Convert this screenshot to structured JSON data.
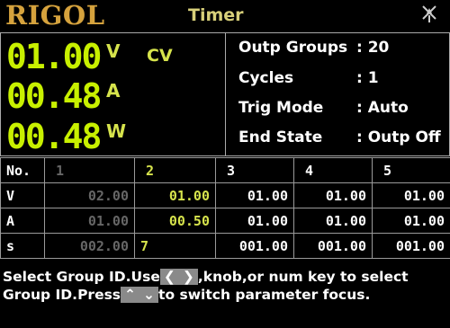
{
  "title_bar": {
    "logo": "RIGOL",
    "mode_title": "Timer",
    "status_icon": "no-network-icon"
  },
  "measurement": {
    "voltage": {
      "value": "01.00",
      "unit": "V"
    },
    "current": {
      "value": "00.48",
      "unit": "A"
    },
    "power": {
      "value": "00.48",
      "unit": "W"
    },
    "mode": "CV"
  },
  "settings": {
    "outp_groups": {
      "label": "Outp Groups",
      "value": ": 20"
    },
    "cycles": {
      "label": "Cycles",
      "value": ": 1"
    },
    "trig_mode": {
      "label": "Trig Mode",
      "value": ": Auto"
    },
    "end_state": {
      "label": "End State",
      "value": ": Outp Off"
    }
  },
  "table": {
    "row_labels": [
      "No.",
      "V",
      "A",
      "s"
    ],
    "groups": [
      {
        "no": "1",
        "v": "02.00",
        "a": "01.00",
        "s": "002.00"
      },
      {
        "no": "2",
        "v": "01.00",
        "a": "00.50",
        "s": "7"
      },
      {
        "no": "3",
        "v": "01.00",
        "a": "01.00",
        "s": "001.00"
      },
      {
        "no": "4",
        "v": "01.00",
        "a": "01.00",
        "s": "001.00"
      },
      {
        "no": "5",
        "v": "01.00",
        "a": "01.00",
        "s": "001.00"
      }
    ]
  },
  "help": {
    "part1": "Select Group ID.Use",
    "left_key": "❮",
    "right_key": "❯",
    "part2": ",knob,or num key to select Group ID.Press",
    "up_key": "⌃",
    "down_key": "⌄",
    "part3": "to switch parameter focus."
  },
  "colors": {
    "accent_yellow": "#d6e34c",
    "measure_green": "#c8f000",
    "logo_orange": "#d5a23d",
    "inactive_gray": "#666666"
  }
}
